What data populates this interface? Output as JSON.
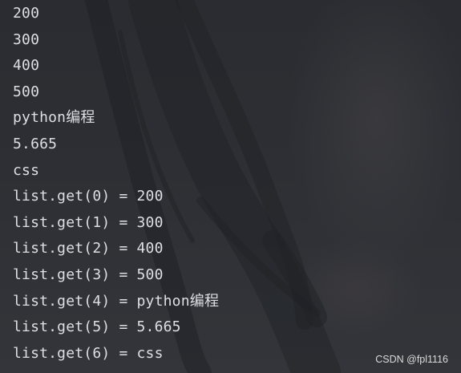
{
  "console": {
    "lines": [
      "200",
      "300",
      "400",
      "500",
      "python编程",
      "5.665",
      "css",
      "list.get(0) = 200",
      "list.get(1) = 300",
      "list.get(2) = 400",
      "list.get(3) = 500",
      "list.get(4) = python编程",
      "list.get(5) = 5.665",
      "list.get(6) = css"
    ],
    "text_color": "#dcdfe4",
    "background_color": "#2b2d31"
  },
  "watermark": {
    "text": "CSDN @fpl1116"
  }
}
